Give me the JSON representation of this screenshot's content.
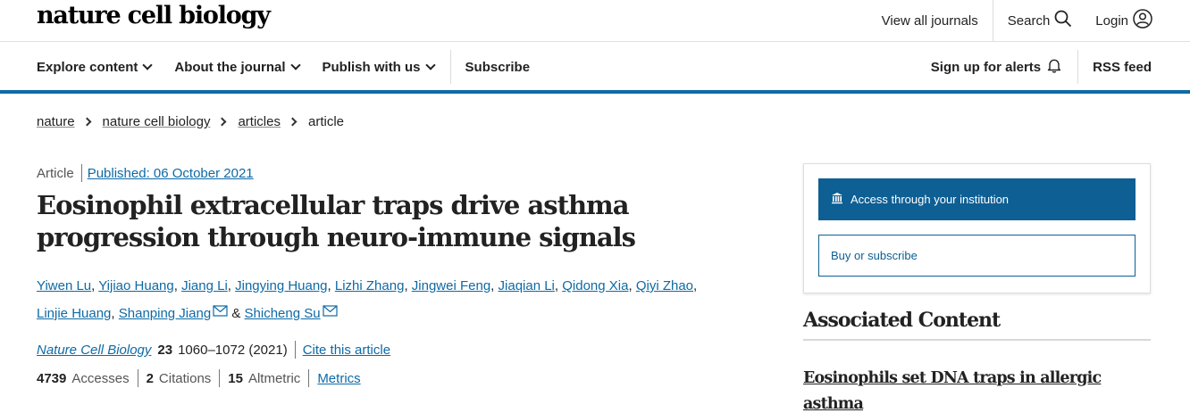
{
  "header": {
    "brand": "nature cell biology",
    "view_all_journals": "View all journals",
    "search_label": "Search",
    "login_label": "Login"
  },
  "nav": {
    "items": [
      "Explore content",
      "About the journal",
      "Publish with us"
    ],
    "subscribe": "Subscribe",
    "alerts": "Sign up for alerts",
    "rss": "RSS feed"
  },
  "breadcrumb": [
    "nature",
    "nature cell biology",
    "articles",
    "article"
  ],
  "article": {
    "type": "Article",
    "published": "Published: 06 October 2021",
    "title": "Eosinophil extracellular traps drive asthma progression through neuro-immune signals",
    "authors_line1": [
      "Yiwen Lu",
      "Yijiao Huang",
      "Jiang Li",
      "Jingying Huang",
      "Lizhi Zhang",
      "Jingwei Feng",
      "Jiaqian Li",
      "Qidong Xia",
      "Qiyi Zhao"
    ],
    "authors_line2": [
      "Linjie Huang",
      "Shanping Jiang"
    ],
    "last_author": "Shicheng Su",
    "ampersand": "&",
    "journal": "Nature Cell Biology",
    "volume": "23",
    "pages_year": "1060–1072 (2021)",
    "cite_label": "Cite this article",
    "accesses_value": "4739",
    "accesses_label": "Accesses",
    "citations_value": "2",
    "citations_label": "Citations",
    "altmetric_value": "15",
    "altmetric_label": "Altmetric",
    "metrics_link": "Metrics"
  },
  "sidebar": {
    "access_institution": "Access through your institution",
    "buy_subscribe": "Buy or subscribe",
    "associated_heading": "Associated Content",
    "associated_link": "Eosinophils set DNA traps in allergic asthma"
  },
  "colors": {
    "accent": "#0d6aa6",
    "button": "#0d5f94"
  }
}
